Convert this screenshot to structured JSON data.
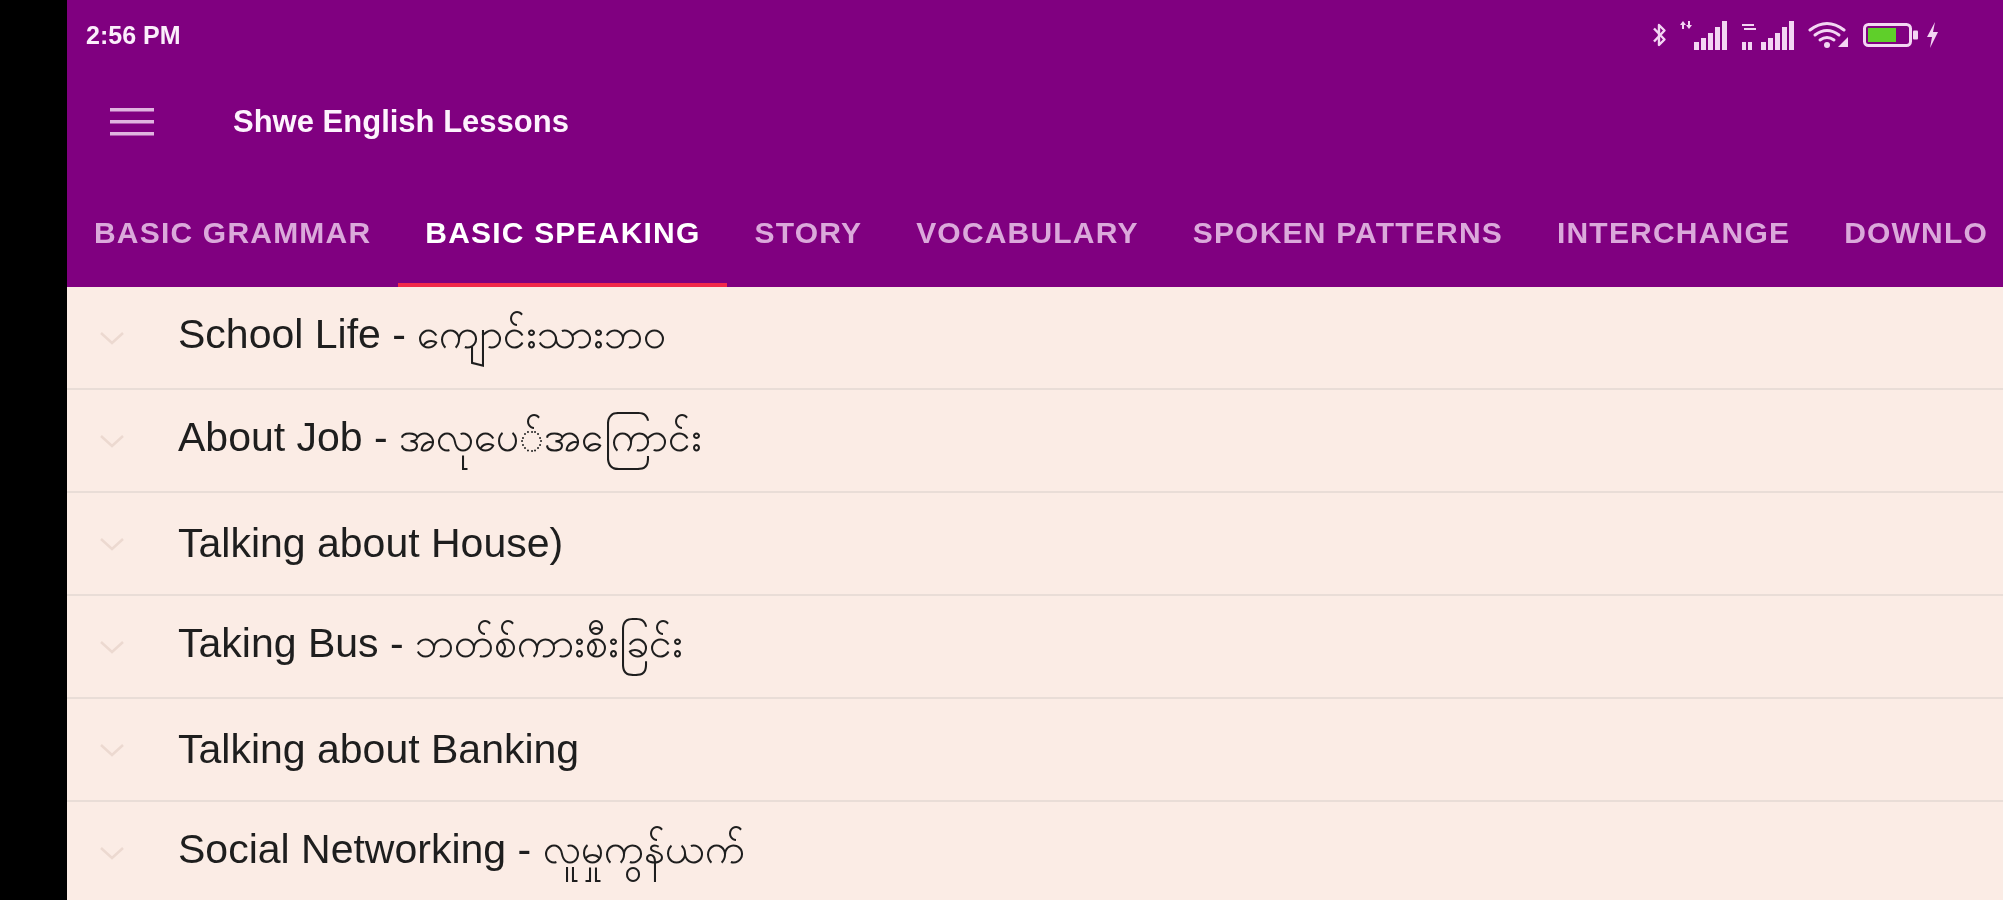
{
  "status_bar": {
    "time": "2:56 PM"
  },
  "app_bar": {
    "title": "Shwe English Lessons"
  },
  "tabs": [
    {
      "label": "BASIC GRAMMAR",
      "selected": false
    },
    {
      "label": "BASIC SPEAKING",
      "selected": true
    },
    {
      "label": "STORY",
      "selected": false
    },
    {
      "label": "VOCABULARY",
      "selected": false
    },
    {
      "label": "SPOKEN PATTERNS",
      "selected": false
    },
    {
      "label": "INTERCHANGE",
      "selected": false
    },
    {
      "label": "DOWNLO",
      "selected": false
    }
  ],
  "lessons": [
    {
      "title": "School Life - ကျောင်းသားဘဝ",
      "expanded": false
    },
    {
      "title": "About Job - အလုပေ်အကြောင်း",
      "expanded": false
    },
    {
      "title": "Talking about House)",
      "expanded": false
    },
    {
      "title": "Taking Bus - ဘတ်စ်ကားစီးခြင်း",
      "expanded": false
    },
    {
      "title": "Talking about Banking",
      "expanded": false
    },
    {
      "title": "Social Networking - လူမှုကွန်ယက်",
      "expanded": false
    }
  ]
}
